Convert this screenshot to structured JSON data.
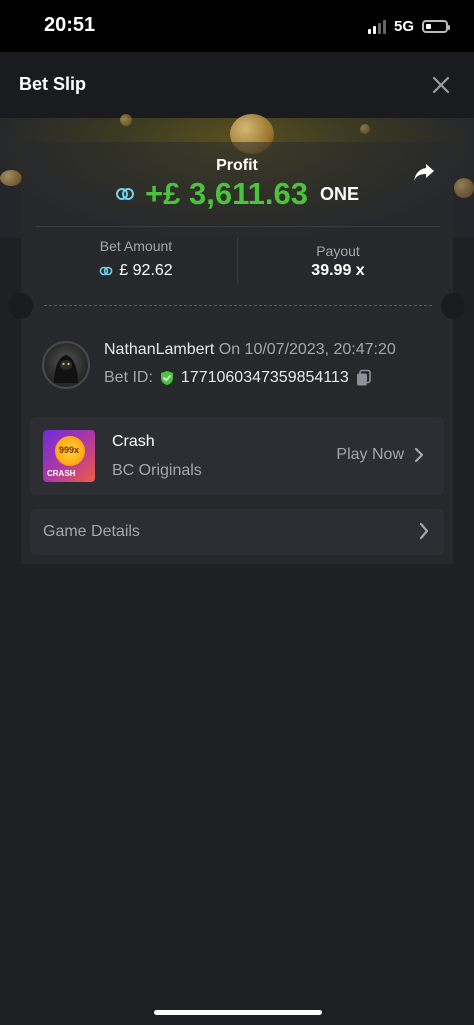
{
  "status_bar": {
    "time": "20:51",
    "network": "5G"
  },
  "header": {
    "title": "Bet Slip"
  },
  "profit": {
    "label": "Profit",
    "amount": "+£ 3,611.63",
    "currency": "ONE"
  },
  "stats": {
    "bet_amount_label": "Bet Amount",
    "bet_amount_value": "£ 92.62",
    "payout_label": "Payout",
    "payout_value": "39.99 x"
  },
  "player": {
    "username": "NathanLambert",
    "date_text": "On 10/07/2023, 20:47:20",
    "bet_id_label": "Bet ID:",
    "bet_id_value": "1771060347359854113"
  },
  "game": {
    "name": "Crash",
    "provider": "BC Originals",
    "play_label": "Play Now",
    "thumb_badge": "999x",
    "thumb_text": "CRASH"
  },
  "details": {
    "label": "Game Details"
  },
  "colors": {
    "profit_green": "#4cc33d",
    "background": "#1f2024",
    "card": "#27282c"
  }
}
